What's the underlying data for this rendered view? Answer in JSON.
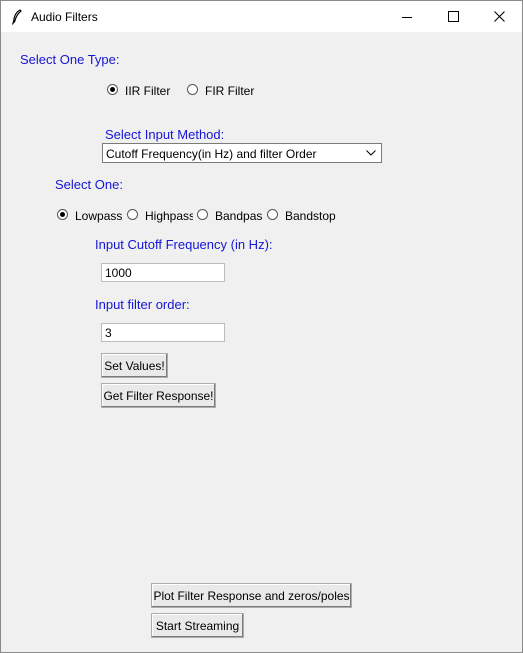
{
  "window": {
    "title": "Audio Filters"
  },
  "type_section": {
    "label": "Select One Type:",
    "options": [
      "IIR Filter",
      "FIR Filter"
    ],
    "selected": "IIR Filter"
  },
  "input_method": {
    "label": "Select Input Method:",
    "selected_value": "Cutoff Frequency(in Hz) and filter Order"
  },
  "band_section": {
    "label": "Select One:",
    "options": [
      "Lowpass",
      "Highpass",
      "Bandpass",
      "Bandstop"
    ],
    "selected": "Lowpass"
  },
  "cutoff": {
    "label": "Input Cutoff Frequency (in Hz):",
    "value": "1000"
  },
  "order": {
    "label": "Input filter order:",
    "value": "3"
  },
  "buttons": {
    "set_values": "Set Values!",
    "get_response": "Get Filter Response!",
    "plot": "Plot Filter Response and zeros/poles",
    "stream": "Start Streaming"
  },
  "colors": {
    "accent_text": "#1515d6",
    "background": "#f0f0f0"
  },
  "icons": [
    "feather-icon",
    "minimize-icon",
    "maximize-icon",
    "close-icon",
    "chevron-down-icon"
  ]
}
